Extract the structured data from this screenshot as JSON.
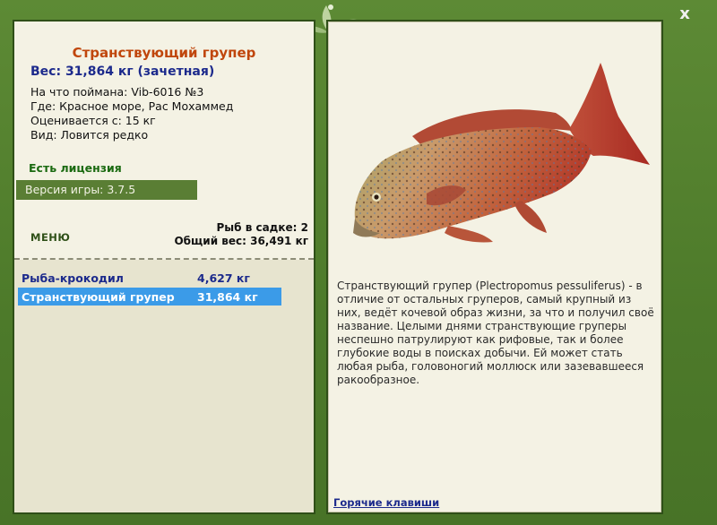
{
  "fish": {
    "title": "Странствующий групер",
    "weight_line": "Вес: 31,864 кг (зачетная)",
    "lure_line": "На что поймана: Vib-6016 №3",
    "place_line": "Где: Красное море, Рас Мохаммед",
    "rated_line": "Оценивается с: 15 кг",
    "kind_line": "Вид: Ловится редко"
  },
  "license": "Есть лицензия",
  "version": "Версия игры: 3.7.5",
  "menu_label": "МЕНЮ",
  "cage": {
    "count_line": "Рыб в садке: 2",
    "total_line": "Общий вес: 36,491 кг"
  },
  "catch_list": [
    {
      "name": "Рыба-крокодил",
      "weight": "4,627 кг"
    },
    {
      "name": "Странствующий групер",
      "weight": "31,864 кг"
    }
  ],
  "description": "Странствующий групер (Plectropomus pessuliferus) - в отличие от остальных груперов, самый крупный из них, ведёт кочевой образ жизни, за что и получил своё название. Целыми днями странствующие груперы неспешно патрулируют как рифовые, так и более глубокие воды в поисках добычи. Ей может стать любая рыба, головоногий моллюск или зазевавшееся ракообразное.",
  "hotkeys_label": "Горячие клавиши",
  "close_label": "x",
  "colors": {
    "frame": "#4f7a2c",
    "panel": "#f4f2e4",
    "title": "#c0460c",
    "accent_blue": "#1c2a8c",
    "selected_row": "#3b9be8",
    "version_bar": "#5a7e34"
  },
  "icons": {
    "close": "close-icon",
    "ornament": "leaf-ornament-icon",
    "fish": "grouper-fish-image"
  }
}
